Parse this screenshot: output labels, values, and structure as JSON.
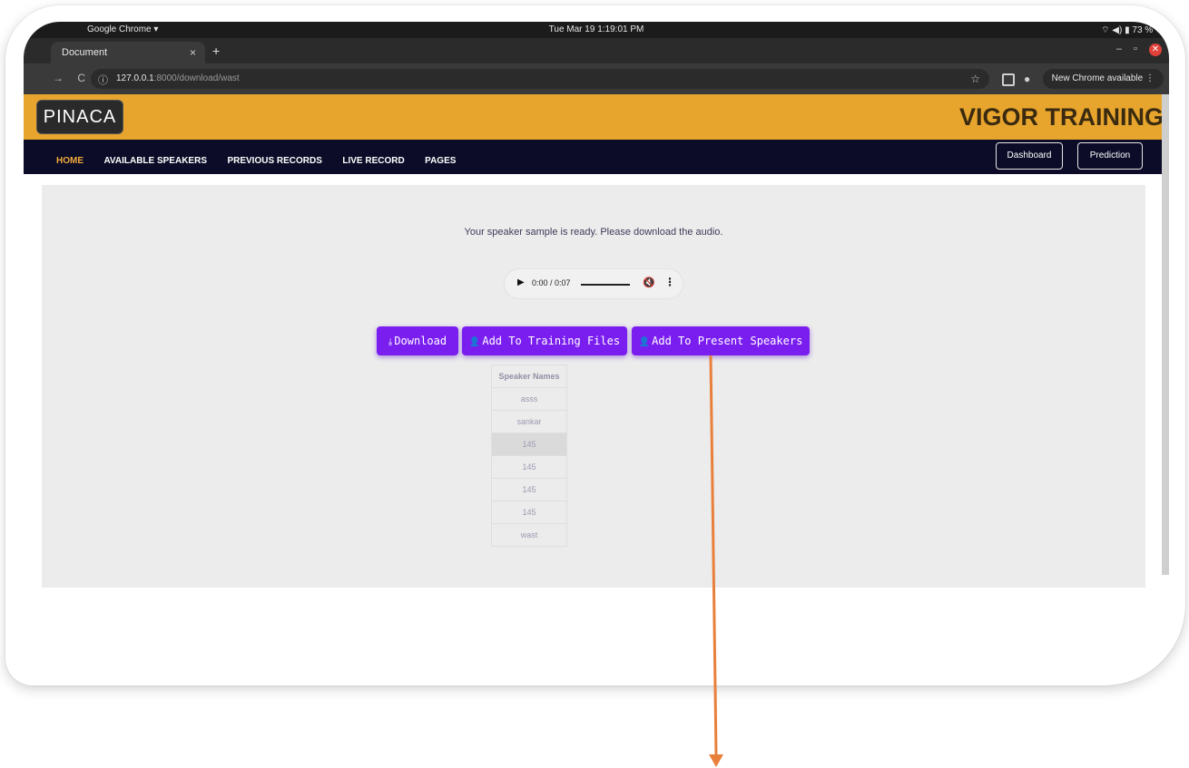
{
  "os_bar": {
    "app": "Google Chrome ▾",
    "datetime": "Tue Mar 19  1:19:01 PM",
    "battery": "73 %"
  },
  "browser": {
    "tab_title": "Document",
    "tab_close": "×",
    "new_tab": "+",
    "url_host": "127.0.0.1",
    "url_rest": ":8000/download/wast",
    "update_label": "New Chrome available"
  },
  "header": {
    "logo": "PINACA",
    "brand": "VIGOR TRAINING"
  },
  "nav": {
    "links": [
      "HOME",
      "AVAILABLE SPEAKERS",
      "PREVIOUS RECORDS",
      "LIVE RECORD",
      "PAGES"
    ],
    "dashboard": "Dashboard",
    "prediction": "Prediction"
  },
  "main": {
    "message": "Your speaker sample is ready. Please download the audio.",
    "player_time": "0:00 / 0:07",
    "download_label": "Download",
    "add_training_label": "Add To Training Files",
    "add_present_label": "Add To Present Speakers"
  },
  "speakers_table": {
    "header": "Speaker Names",
    "rows": [
      "asss",
      "sankar",
      "145",
      "145",
      "145",
      "145",
      "wast"
    ]
  },
  "colors": {
    "header_bg": "#e7a52d",
    "nav_bg": "#0c0c28",
    "button_bg": "#7a1ef0",
    "arrow": "#e8803c"
  }
}
